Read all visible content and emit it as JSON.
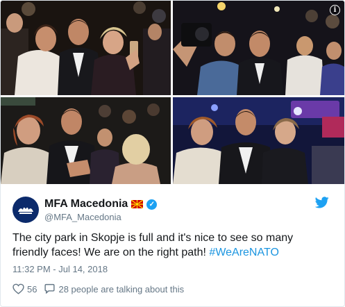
{
  "tweet": {
    "display_name": "MFA Macedonia",
    "handle": "@MFA_Macedonia",
    "text": "The city park in Skopje is full and it's nice to see so many friendly faces! We are on the right path! ",
    "hashtag": "#WeAreNATO",
    "timestamp": "11:32 PM - Jul 14, 2018",
    "likes": "56",
    "conversation": "28 people are talking about this"
  },
  "icons": {
    "bird": "twitter-bird-icon",
    "verified": "verified-badge-icon",
    "flag": "macedonia-flag-icon",
    "like": "heart-icon",
    "reply": "speech-bubble-icon",
    "info": "info-icon"
  },
  "colors": {
    "brand_blue": "#1da1f2",
    "link_blue": "#1b95e0",
    "secondary_text": "#657786",
    "avatar_bg": "#0b2a6b"
  }
}
